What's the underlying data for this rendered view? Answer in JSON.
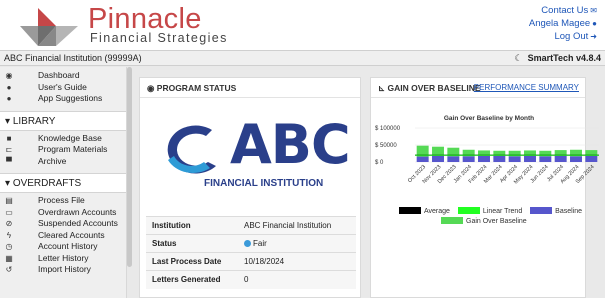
{
  "header": {
    "brand_name": "Pinnacle",
    "brand_tagline": "Financial Strategies",
    "contact_label": "Contact Us",
    "user_name": "Angela Magee",
    "logout_label": "Log Out"
  },
  "topbar": {
    "institution": "ABC Financial Institution (99999A)",
    "version": "SmartTech v4.8.4"
  },
  "sidebar": {
    "top_items": [
      {
        "label": "Dashboard",
        "icon": "dashboard-icon"
      },
      {
        "label": "User's Guide",
        "icon": "info-icon"
      },
      {
        "label": "App Suggestions",
        "icon": "comment-icon"
      }
    ],
    "library_header": "LIBRARY",
    "library_items": [
      {
        "label": "Knowledge Base",
        "icon": "folder-icon"
      },
      {
        "label": "Program Materials",
        "icon": "sitemap-icon"
      },
      {
        "label": "Archive",
        "icon": "archive-icon"
      }
    ],
    "overdrafts_header": "OVERDRAFTS",
    "overdraft_items": [
      {
        "label": "Process File",
        "icon": "file-icon"
      },
      {
        "label": "Overdrawn Accounts",
        "icon": "card-icon"
      },
      {
        "label": "Suspended Accounts",
        "icon": "ban-icon"
      },
      {
        "label": "Cleared Accounts",
        "icon": "bolt-icon"
      },
      {
        "label": "Account History",
        "icon": "clock-icon"
      },
      {
        "label": "Letter History",
        "icon": "calendar-icon"
      },
      {
        "label": "Import History",
        "icon": "history-icon"
      }
    ]
  },
  "program_status": {
    "title": "PROGRAM STATUS",
    "logo_text": "ABC",
    "logo_subtext": "FINANCIAL INSTITUTION",
    "rows": [
      {
        "key": "Institution",
        "value": "ABC Financial Institution"
      },
      {
        "key": "Status",
        "value": "Fair"
      },
      {
        "key": "Last Process Date",
        "value": "10/18/2024"
      },
      {
        "key": "Letters Generated",
        "value": "0"
      }
    ]
  },
  "gain_panel": {
    "title": "GAIN OVER BASELINE",
    "link_label": "PERFORMANCE SUMMARY"
  },
  "chart_data": {
    "type": "bar",
    "title": "Gain Over Baseline by Month",
    "categories": [
      "Oct 2023",
      "Nov 2023",
      "Dec 2023",
      "Jan 2024",
      "Feb 2024",
      "Mar 2024",
      "Apr 2024",
      "May 2024",
      "Jun 2024",
      "Jul 2024",
      "Aug 2024",
      "Sep 2024"
    ],
    "ytick_labels": [
      "$ 100000",
      "$ 50000",
      "$ 0"
    ],
    "ylim": [
      0,
      100000
    ],
    "series": [
      {
        "name": "Gain Over Baseline",
        "color": "#55d955",
        "values": [
          48000,
          45000,
          42000,
          36000,
          34000,
          33000,
          33000,
          34000,
          33000,
          35000,
          36000,
          35000
        ]
      },
      {
        "name": "Baseline",
        "color": "#5656cc",
        "values": [
          16000,
          18000,
          17000,
          17000,
          18000,
          18000,
          17000,
          18000,
          17000,
          18000,
          17000,
          18000
        ]
      }
    ],
    "lines": [
      {
        "name": "Average",
        "color": "#000000",
        "value": 20000
      },
      {
        "name": "Linear Trend",
        "color": "#22ff22",
        "value": 20000
      }
    ],
    "legend": [
      "Average",
      "Linear Trend",
      "Baseline",
      "Gain Over Baseline"
    ],
    "legend_position": "bottom"
  }
}
